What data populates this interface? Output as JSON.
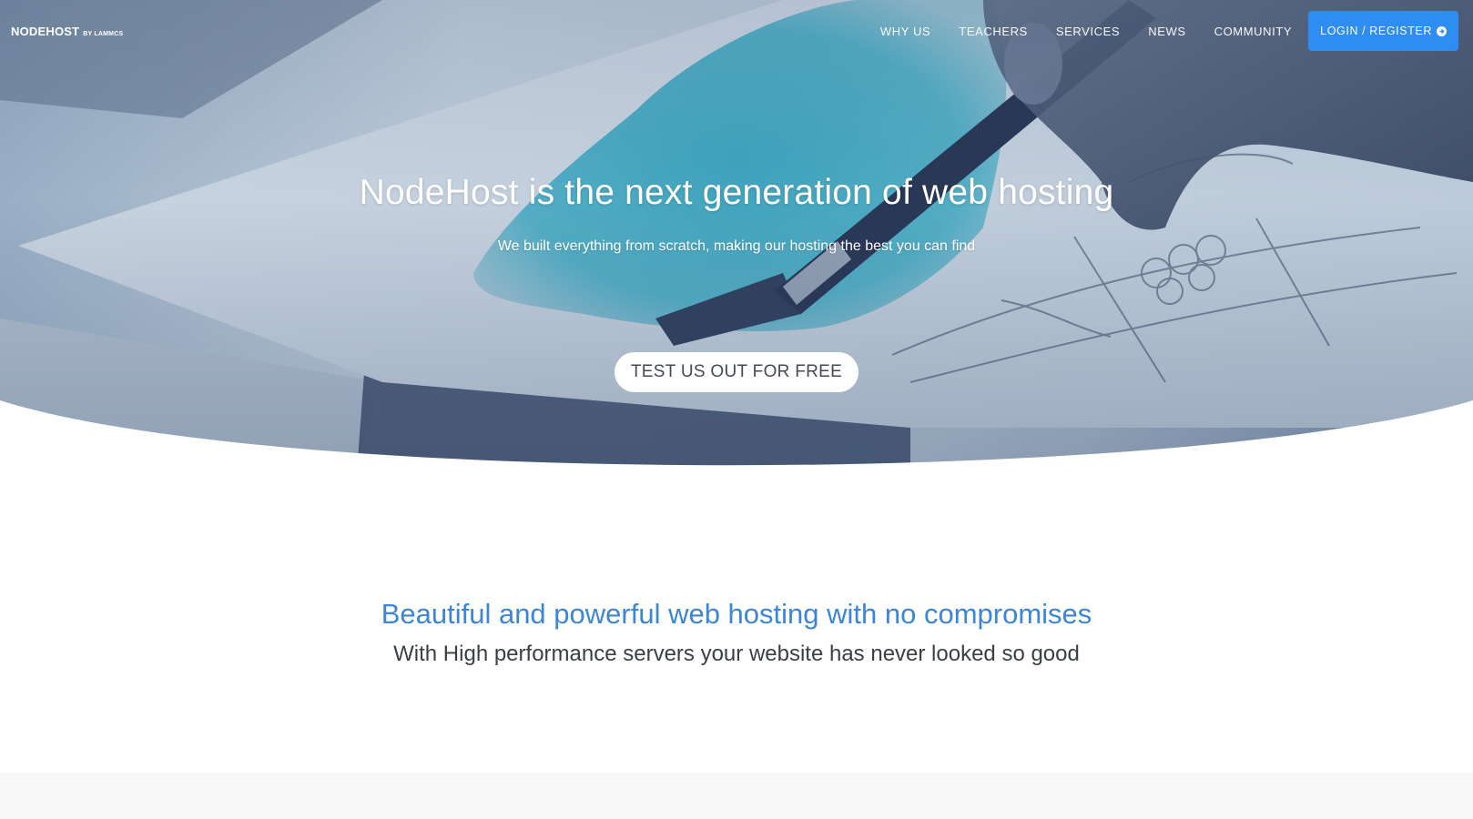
{
  "brand": {
    "name": "NODEHOST",
    "sub": "BY LAMMCS"
  },
  "nav": {
    "links": [
      "WHY US",
      "TEACHERS",
      "SERVICES",
      "NEWS",
      "COMMUNITY"
    ],
    "login_label": "LOGIN / REGISTER",
    "login_icon": "arrow-circle-right-icon",
    "login_color": "#2d8df0"
  },
  "hero": {
    "title": "NodeHost is the next generation of web hosting",
    "subtitle": "We built everything from scratch, making our hosting the best you can find",
    "cta_label": "TEST US OUT FOR FREE"
  },
  "section": {
    "title": "Beautiful and powerful web hosting with no compromises",
    "subtitle": "With High performance servers your website has never looked so good",
    "title_color": "#3b86d6"
  }
}
